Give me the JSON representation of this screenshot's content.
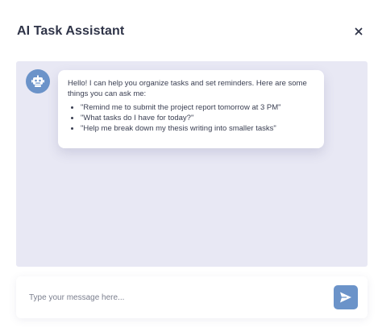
{
  "header": {
    "title": "AI Task Assistant",
    "close_icon": "close-icon"
  },
  "chat": {
    "messages": [
      {
        "sender": "assistant",
        "avatar_icon": "robot-icon",
        "intro": "Hello! I can help you organize tasks and set reminders. Here are some things you can ask me:",
        "suggestions": [
          "\"Remind me to submit the project report tomorrow at 3 PM\"",
          "\"What tasks do I have for today?\"",
          "\"Help me break down my thesis writing into smaller tasks\""
        ]
      }
    ]
  },
  "composer": {
    "placeholder": "Type your message here...",
    "value": "",
    "send_icon": "send-icon"
  },
  "colors": {
    "accent": "#6b93c9",
    "chat_background": "#e8e8f4",
    "title_text": "#2f3448",
    "body_text": "#3a3f52",
    "placeholder_text": "#7b7f8e"
  }
}
